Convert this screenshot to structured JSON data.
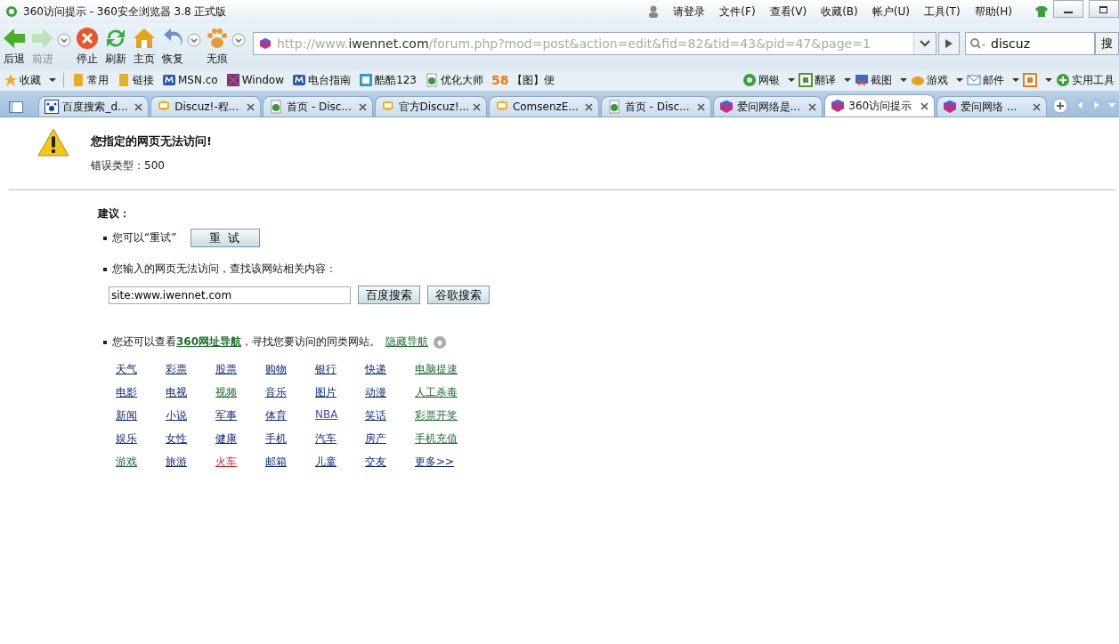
{
  "window": {
    "title": "360访问提示 - 360安全浏览器 3.8 正式版",
    "login": "请登录",
    "menus": [
      "文件(F)",
      "查看(V)",
      "收藏(B)",
      "帐户(U)",
      "工具(T)",
      "帮助(H)"
    ]
  },
  "toolbar": [
    {
      "kind": "back",
      "label": "后退",
      "disabled": false,
      "dropdown": false
    },
    {
      "kind": "forward",
      "label": "前进",
      "disabled": true,
      "dropdown": true
    },
    {
      "kind": "stop",
      "label": "停止",
      "disabled": false,
      "dropdown": false
    },
    {
      "kind": "refresh",
      "label": "刷新",
      "disabled": false,
      "dropdown": false
    },
    {
      "kind": "home",
      "label": "主页",
      "disabled": false,
      "dropdown": false
    },
    {
      "kind": "undo",
      "label": "恢复",
      "disabled": false,
      "dropdown": true
    },
    {
      "kind": "paw",
      "label": "无痕",
      "disabled": false,
      "dropdown": true
    }
  ],
  "address": {
    "scheme": "http://www.",
    "domain": "iwennet.com",
    "path": "/forum.php?mod=post&action=edit&fid=82&tid=43&pid=47&page=1"
  },
  "search": {
    "value": "discuz",
    "button": "搜"
  },
  "bookmarks": [
    {
      "kind": "star",
      "label": "收藏"
    },
    {
      "kind": "folder",
      "label": "常用"
    },
    {
      "kind": "folder",
      "label": "链接"
    },
    {
      "kind": "m",
      "label": "MSN.co"
    },
    {
      "kind": "window",
      "label": "Window"
    },
    {
      "kind": "m",
      "label": "电台指南"
    },
    {
      "kind": "cool",
      "label": "酷酷123"
    },
    {
      "kind": "page",
      "label": "优化大师"
    },
    {
      "kind": "num",
      "label": "【图】便",
      "prefix": "58"
    }
  ],
  "tools": [
    {
      "kind": "bank",
      "label": "网银"
    },
    {
      "kind": "translate",
      "label": "翻译"
    },
    {
      "kind": "screenshot",
      "label": "截图"
    },
    {
      "kind": "game",
      "label": "游戏"
    },
    {
      "kind": "mail",
      "label": "邮件"
    },
    {
      "kind": "group"
    },
    {
      "kind": "plus",
      "label": "实用工具"
    }
  ],
  "tabs": [
    {
      "kind": "paw",
      "label": "百度搜索_d...",
      "selected": false
    },
    {
      "kind": "bubble",
      "label": "Discuz!-程...",
      "selected": false
    },
    {
      "kind": "page",
      "label": "首页 - Disc...",
      "selected": false
    },
    {
      "kind": "bubble",
      "label": "官方Discuz!...",
      "selected": false
    },
    {
      "kind": "bubble",
      "label": "ComsenzE...",
      "selected": false
    },
    {
      "kind": "page",
      "label": "首页 - Disc...",
      "selected": false
    },
    {
      "kind": "cube",
      "label": "爱问网络是...",
      "selected": false
    },
    {
      "kind": "cube",
      "label": "360访问提示",
      "selected": true
    },
    {
      "kind": "cube",
      "label": "爱问网络 ...",
      "selected": false
    }
  ],
  "page": {
    "heading": "您指定的网页无法访问!",
    "error_type": "错误类型：500",
    "suggest_title": "建议：",
    "retry_text": "您可以“重试”",
    "retry_button": "重 试",
    "search_prompt": "您输入的网页无法访问，查找该网站相关内容：",
    "site_query": "site:www.iwennet.com",
    "search_buttons": [
      "百度搜索",
      "谷歌搜索"
    ],
    "nav_before": "您还可以查看",
    "nav_link": "360网址导航",
    "nav_after": "，寻找您要访问的同类网站。",
    "hide_link": "隐藏导航",
    "links": [
      [
        {
          "label": "天气",
          "color": "#0a2a7a"
        },
        {
          "label": "彩票",
          "color": "#0a2a7a"
        },
        {
          "label": "股票",
          "color": "#0a2a7a"
        },
        {
          "label": "购物",
          "color": "#0a2a7a"
        },
        {
          "label": "银行",
          "color": "#0a2a7a"
        },
        {
          "label": "快递",
          "color": "#0a2a7a"
        },
        {
          "label": "电脑提速",
          "color": "#1e6b2e"
        }
      ],
      [
        {
          "label": "电影",
          "color": "#0a2a7a"
        },
        {
          "label": "电视",
          "color": "#0a2a7a"
        },
        {
          "label": "视频",
          "color": "#1e6b2e"
        },
        {
          "label": "音乐",
          "color": "#0a2a7a"
        },
        {
          "label": "图片",
          "color": "#0a2a7a"
        },
        {
          "label": "动漫",
          "color": "#0a2a7a"
        },
        {
          "label": "人工杀毒",
          "color": "#1e6b2e"
        }
      ],
      [
        {
          "label": "新闻",
          "color": "#0a2a7a"
        },
        {
          "label": "小说",
          "color": "#0a2a7a"
        },
        {
          "label": "军事",
          "color": "#0a2a7a"
        },
        {
          "label": "体育",
          "color": "#0a2a7a"
        },
        {
          "label": "NBA",
          "color": "#4a4aa8"
        },
        {
          "label": "笑话",
          "color": "#0a2a7a"
        },
        {
          "label": "彩票开奖",
          "color": "#1e6b2e"
        }
      ],
      [
        {
          "label": "娱乐",
          "color": "#0a2a7a"
        },
        {
          "label": "女性",
          "color": "#0a2a7a"
        },
        {
          "label": "健康",
          "color": "#0a2a7a"
        },
        {
          "label": "手机",
          "color": "#0a2a7a"
        },
        {
          "label": "汽车",
          "color": "#0a2a7a"
        },
        {
          "label": "房产",
          "color": "#0a2a7a"
        },
        {
          "label": "手机充值",
          "color": "#1e6b2e"
        }
      ],
      [
        {
          "label": "游戏",
          "color": "#1e6b2e"
        },
        {
          "label": "旅游",
          "color": "#0a2a7a"
        },
        {
          "label": "火车",
          "color": "#cc2222"
        },
        {
          "label": "邮箱",
          "color": "#0a2a7a"
        },
        {
          "label": "儿童",
          "color": "#0a2a7a"
        },
        {
          "label": "交友",
          "color": "#0a2a7a"
        },
        {
          "label": "更多>>",
          "color": "#0a2a7a"
        }
      ]
    ]
  }
}
